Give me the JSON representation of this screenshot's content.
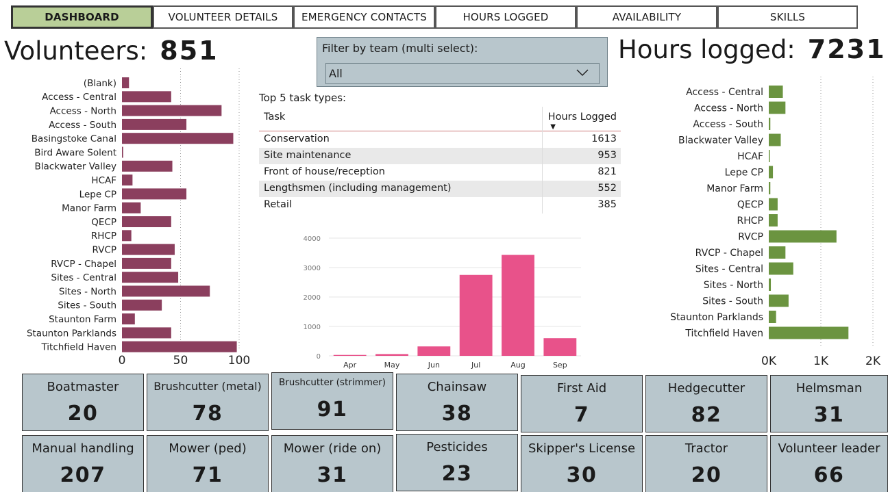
{
  "tabs": [
    {
      "label": "DASHBOARD",
      "active": true
    },
    {
      "label": "VOLUNTEER DETAILS",
      "active": false
    },
    {
      "label": "EMERGENCY CONTACTS",
      "active": false
    },
    {
      "label": "HOURS LOGGED",
      "active": false
    },
    {
      "label": "AVAILABILITY",
      "active": false
    },
    {
      "label": "SKILLS",
      "active": false
    }
  ],
  "volunteers": {
    "label": "Volunteers:",
    "value": "851"
  },
  "hours": {
    "label": "Hours logged:",
    "value": "7231"
  },
  "filter": {
    "title": "Filter by team (multi select):",
    "selected": "All"
  },
  "top_tasks": {
    "title": "Top 5 task types:",
    "columns": [
      "Task",
      "Hours Logged"
    ],
    "rows": [
      {
        "task": "Conservation",
        "hours": "1613"
      },
      {
        "task": "Site maintenance",
        "hours": "953"
      },
      {
        "task": "Front of house/reception",
        "hours": "821"
      },
      {
        "task": "Lengthsmen (including management)",
        "hours": "552"
      },
      {
        "task": "Retail",
        "hours": "385"
      }
    ]
  },
  "colors": {
    "volunteer_bar": "#8b3f5e",
    "month_bar": "#e8528a",
    "hours_bar": "#6b9440",
    "card_bg": "#b8c6cc",
    "active_tab": "#b9cf98"
  },
  "chart_data": [
    {
      "type": "bar",
      "orientation": "horizontal",
      "categories": [
        "(Blank)",
        "Access - Central",
        "Access - North",
        "Access - South",
        "Basingstoke Canal",
        "Bird Aware Solent",
        "Blackwater Valley",
        "HCAF",
        "Lepe CP",
        "Manor Farm",
        "QECP",
        "RHCP",
        "RVCP",
        "RVCP - Chapel",
        "Sites - Central",
        "Sites - North",
        "Sites - South",
        "Staunton Farm",
        "Staunton Parklands",
        "Titchfield Haven"
      ],
      "values": [
        6,
        42,
        85,
        55,
        95,
        1,
        43,
        9,
        55,
        16,
        42,
        8,
        45,
        42,
        48,
        75,
        34,
        11,
        42,
        98
      ],
      "xlim": [
        0,
        100
      ],
      "xticks": [
        "0",
        "50",
        "100"
      ],
      "grid": true
    },
    {
      "type": "bar",
      "categories": [
        "Apr",
        "May",
        "Jun",
        "Jul",
        "Aug",
        "Sep"
      ],
      "values": [
        30,
        60,
        320,
        2750,
        3430,
        600
      ],
      "ylim": [
        0,
        4000
      ],
      "yticks": [
        "0",
        "1000",
        "2000",
        "3000",
        "4000"
      ],
      "grid": true
    },
    {
      "type": "bar",
      "orientation": "horizontal",
      "categories": [
        "Access - Central",
        "Access - North",
        "Access - South",
        "Blackwater Valley",
        "HCAF",
        "Lepe CP",
        "Manor Farm",
        "QECP",
        "RHCP",
        "RVCP",
        "RVCP - Chapel",
        "Sites - Central",
        "Sites - North",
        "Sites - South",
        "Staunton Parklands",
        "Titchfield Haven"
      ],
      "values": [
        270,
        320,
        30,
        230,
        10,
        80,
        30,
        170,
        170,
        1300,
        320,
        470,
        40,
        380,
        140,
        1530
      ],
      "xlim": [
        0,
        2000
      ],
      "xticks": [
        "0K",
        "1K",
        "2K"
      ],
      "grid": true
    }
  ],
  "skills": [
    {
      "name": "Boatmaster",
      "value": "20"
    },
    {
      "name": "Brushcutter (metal)",
      "value": "78"
    },
    {
      "name": "Brushcutter (strimmer)",
      "value": "91"
    },
    {
      "name": "Chainsaw",
      "value": "38"
    },
    {
      "name": "First Aid",
      "value": "7"
    },
    {
      "name": "Hedgecutter",
      "value": "82"
    },
    {
      "name": "Helmsman",
      "value": "31"
    },
    {
      "name": "Manual handling",
      "value": "207"
    },
    {
      "name": "Mower (ped)",
      "value": "71"
    },
    {
      "name": "Mower (ride on)",
      "value": "31"
    },
    {
      "name": "Pesticides",
      "value": "23"
    },
    {
      "name": "Skipper's License",
      "value": "30"
    },
    {
      "name": "Tractor",
      "value": "20"
    },
    {
      "name": "Volunteer leader",
      "value": "66"
    }
  ]
}
